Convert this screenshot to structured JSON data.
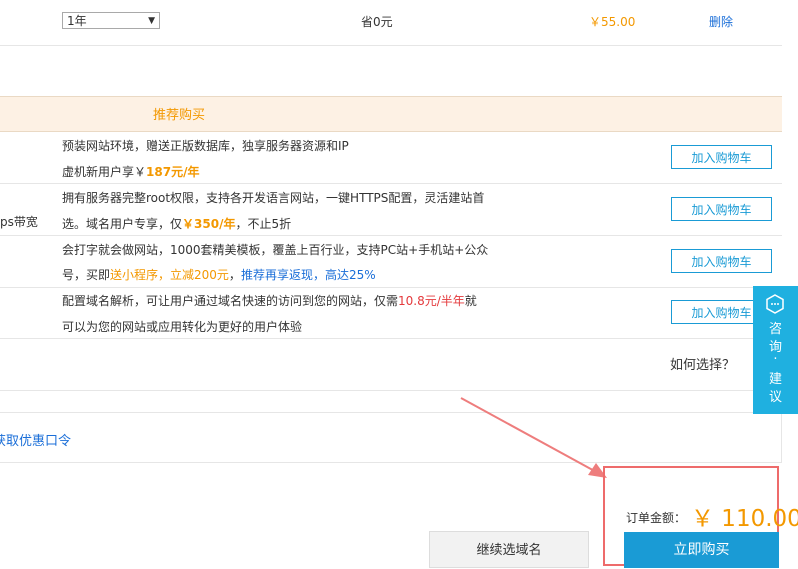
{
  "top_row": {
    "period_select": "1年",
    "savings": "省0元",
    "price": "￥55.00",
    "delete_label": "删除"
  },
  "recommend": {
    "title": "推荐购买",
    "items": [
      {
        "line1": "预装网站环境，赠送正版数据库，独享服务器资源和IP",
        "line2_prefix": "虚机新用户享￥",
        "line2_hl": "187元/年",
        "button": "加入购物车"
      },
      {
        "left_label": "ps带宽",
        "line1": "拥有服务器完整root权限，支持各开发语言网站，一键HTTPS配置，灵活建站首",
        "line2_prefix": "选。域名用户专享，仅",
        "line2_hl": "￥350/年",
        "line2_suffix": "，不止5折",
        "button": "加入购物车"
      },
      {
        "line1": "会打字就会做网站，1000套精美模板，覆盖上百行业，支持PC站+手机站+公众",
        "line2_prefix": "号，买即",
        "line2_hl": "送小程序，立减200元",
        "line2_mid": "，",
        "line2_blue": "推荐再享返现，高达25%",
        "button": "加入购物车"
      },
      {
        "line1_prefix": "配置域名解析，可让用户通过域名快速的访问到您的网站，仅需",
        "line1_red": "10.8元/半年",
        "line1_suffix": "就",
        "line2": "可以为您的网站或应用转化为更好的用户体验",
        "button": "加入购物车"
      }
    ]
  },
  "how_to_choose": "如何选择？",
  "coupon_link": "获取优惠口令",
  "side_widget": {
    "chars": [
      "咨",
      "询",
      "·",
      "建",
      "议"
    ],
    "icon": "hexagon-chat-icon"
  },
  "order": {
    "amount_label": "订单金额：",
    "amount_value": "￥ 110.00",
    "buy_now": "立即购买",
    "continue": "继续选域名"
  },
  "colors": {
    "accent_blue": "#1a9bd5",
    "orange": "#f39800",
    "highlight_border": "#ee6b6b",
    "arrow": "#ee7d7d"
  }
}
